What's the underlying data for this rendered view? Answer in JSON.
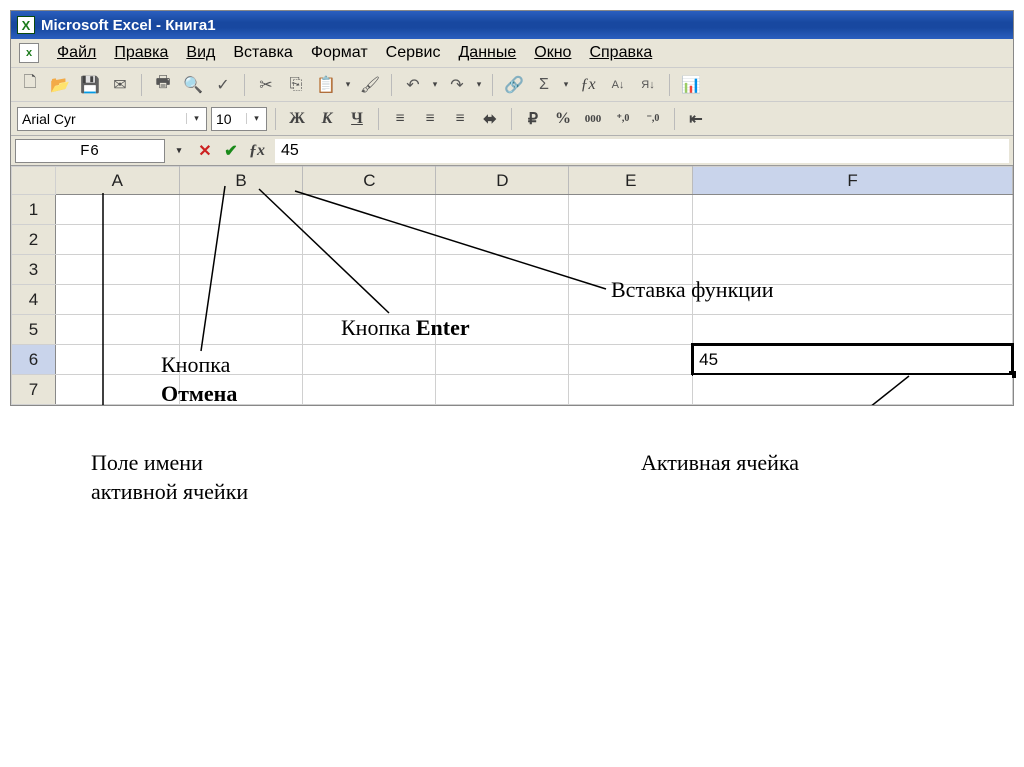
{
  "title": "Microsoft Excel - Книга1",
  "menu": {
    "items": [
      "Файл",
      "Правка",
      "Вид",
      "Вставка",
      "Формат",
      "Сервис",
      "Данные",
      "Окно",
      "Справка"
    ]
  },
  "toolbar": {
    "new": "□",
    "open": "📂",
    "save": "💾",
    "print": "🖨",
    "preview": "🔍",
    "spell": "✓",
    "cut": "✂",
    "copy": "⎘",
    "paste": "📋",
    "format_painter": "🖌",
    "undo": "↶",
    "redo": "↷",
    "hyperlink": "🔗",
    "autosum": "Σ",
    "fx": "ƒx",
    "sort_asc": "A↓",
    "sort_desc": "Я↓"
  },
  "format": {
    "font_name": "Arial Cyr",
    "font_size": "10",
    "bold": "Ж",
    "italic": "К",
    "underline": "Ч",
    "currency": "%",
    "percent": "%",
    "comma": "000",
    "inc_dec1": ",0",
    "inc_dec2": ",00"
  },
  "formula_bar": {
    "name_box": "F6",
    "formula_value": "45"
  },
  "columns": [
    "A",
    "B",
    "C",
    "D",
    "E",
    "F"
  ],
  "rows": [
    "1",
    "2",
    "3",
    "4",
    "5",
    "6",
    "7"
  ],
  "active_cell": {
    "col": "F",
    "row": "6",
    "value": "45"
  },
  "annotations": {
    "name_box": "Поле имени\nактивной ячейки",
    "cancel": "Кнопка",
    "cancel_bold": "Отмена",
    "enter": "Кнопка",
    "enter_bold": "Enter",
    "insert_fn": "Вставка функции",
    "active_cell": "Активная ячейка"
  }
}
